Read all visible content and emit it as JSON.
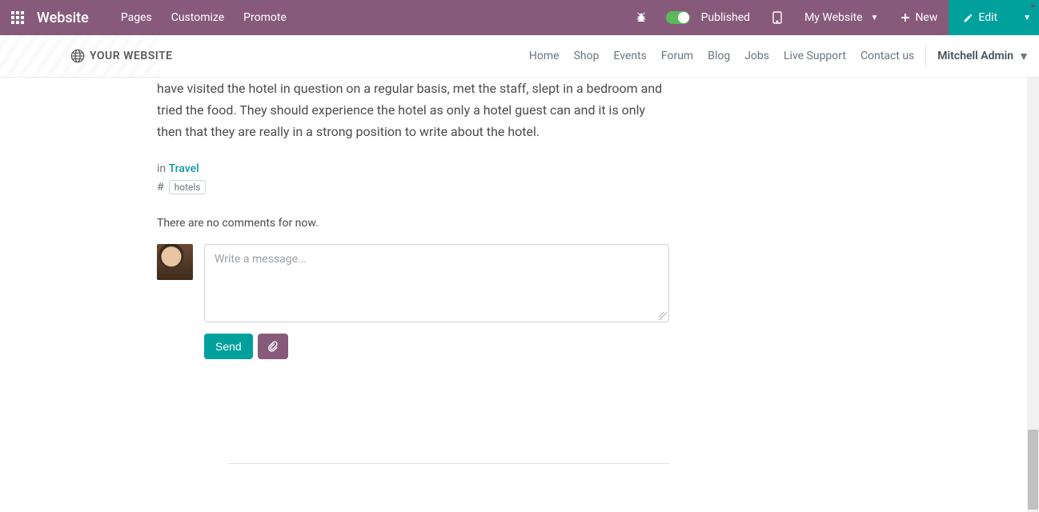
{
  "sysbar": {
    "brand": "Website",
    "menu": {
      "pages": "Pages",
      "customize": "Customize",
      "promote": "Promote"
    },
    "published": "Published",
    "my_website": "My Website",
    "new_label": "New",
    "edit_label": "Edit"
  },
  "sitenav": {
    "logo_text": "YOUR WEBSITE",
    "links": {
      "home": "Home",
      "shop": "Shop",
      "events": "Events",
      "forum": "Forum",
      "blog": "Blog",
      "jobs": "Jobs",
      "live_support": "Live Support",
      "contact": "Contact us"
    },
    "user": "Mitchell Admin"
  },
  "article": {
    "body": "have visited the hotel in question on a regular basis, met the staff, slept in a bedroom and tried the food. They should experience the hotel as only a hotel guest can and it is only then that they are really in a strong position to write about the hotel.",
    "in_prefix": "in ",
    "category": "Travel",
    "tag_glyph": "#",
    "tag": "hotels",
    "no_comments": "There are no comments for now.",
    "composer_placeholder": "Write a message...",
    "send_label": "Send"
  }
}
